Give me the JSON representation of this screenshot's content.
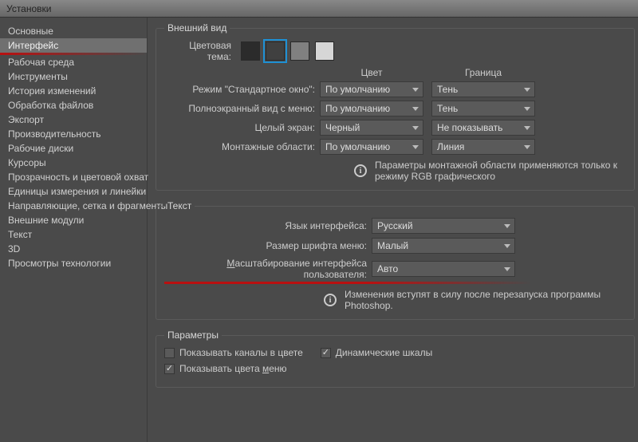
{
  "window": {
    "title": "Установки"
  },
  "sidebar": {
    "items": [
      {
        "label": "Основные"
      },
      {
        "label": "Интерфейс",
        "selected": true
      },
      {
        "label": "Рабочая среда"
      },
      {
        "label": "Инструменты"
      },
      {
        "label": "История изменений"
      },
      {
        "label": "Обработка файлов"
      },
      {
        "label": "Экспорт"
      },
      {
        "label": "Производительность"
      },
      {
        "label": "Рабочие диски"
      },
      {
        "label": "Курсоры"
      },
      {
        "label": "Прозрачность и цветовой охват"
      },
      {
        "label": "Единицы измерения и линейки"
      },
      {
        "label": "Направляющие, сетка и фрагменты"
      },
      {
        "label": "Внешние модули"
      },
      {
        "label": "Текст"
      },
      {
        "label": "3D"
      },
      {
        "label": "Просмотры технологии"
      }
    ]
  },
  "appearance": {
    "legend": "Внешний вид",
    "theme_label": "Цветовая тема:",
    "swatches": [
      "#2b2b2b",
      "#404040",
      "#808080",
      "#d6d6d6"
    ],
    "selected_swatch": 1,
    "col_headers": {
      "c1": "Цвет",
      "c2": "Граница"
    },
    "rows": [
      {
        "label": "Режим \"Стандартное окно\":",
        "c1": "По умолчанию",
        "c2": "Тень"
      },
      {
        "label": "Полноэкранный вид с меню:",
        "c1": "По умолчанию",
        "c2": "Тень"
      },
      {
        "label": "Целый экран:",
        "c1": "Черный",
        "c2": "Не показывать"
      },
      {
        "label": "Монтажные области:",
        "c1": "По умолчанию",
        "c2": "Линия"
      }
    ],
    "info": "Параметры монтажной области применяются только к режиму RGB графического"
  },
  "text": {
    "legend": "Текст",
    "lang_label": "Язык интерфейса:",
    "lang_value": "Русский",
    "font_label": "Размер шрифта меню:",
    "font_value": "Малый",
    "scale_label_pre": "М",
    "scale_label_rest": "асштабирование интерфейса пользователя:",
    "scale_value": "Авто",
    "info": "Изменения вступят в силу после перезапуска программы Photoshop."
  },
  "params": {
    "legend": "Параметры",
    "chk1": {
      "label": "Показывать каналы в цвете",
      "checked": false
    },
    "chk2": {
      "label": "Динамические шкалы",
      "checked": true
    },
    "chk3_pre": "Показывать цвета ",
    "chk3_under": "м",
    "chk3_post": "еню",
    "chk3_checked": true
  }
}
